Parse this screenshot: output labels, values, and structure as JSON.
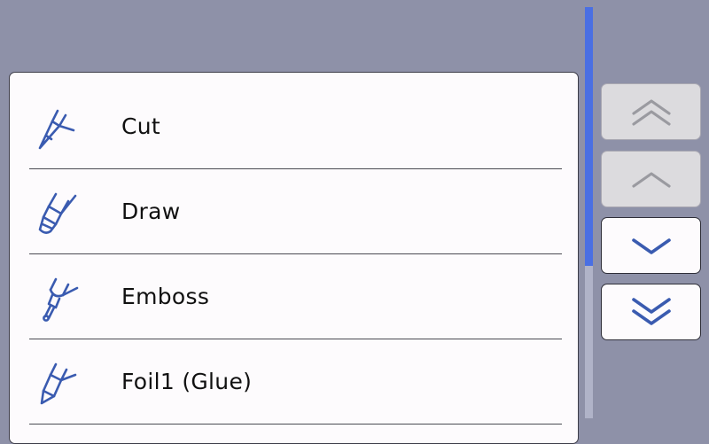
{
  "tools": [
    {
      "label": "Cut",
      "icon": "cut-blade-icon"
    },
    {
      "label": "Draw",
      "icon": "pen-icon"
    },
    {
      "label": "Emboss",
      "icon": "emboss-stylus-icon"
    },
    {
      "label": "Foil1 (Glue)",
      "icon": "foil-pen-icon"
    }
  ],
  "scroll": {
    "thumb_color": "#4a6fe3"
  },
  "nav": {
    "page_up": {
      "icon": "double-chevron-up-icon",
      "enabled": false
    },
    "line_up": {
      "icon": "chevron-up-icon",
      "enabled": false
    },
    "line_down": {
      "icon": "chevron-down-icon",
      "enabled": true
    },
    "page_down": {
      "icon": "double-chevron-down-icon",
      "enabled": true
    }
  },
  "colors": {
    "background": "#8e91a8",
    "icon": "#3a5bb0",
    "disabled_icon": "#9a9aa0"
  }
}
